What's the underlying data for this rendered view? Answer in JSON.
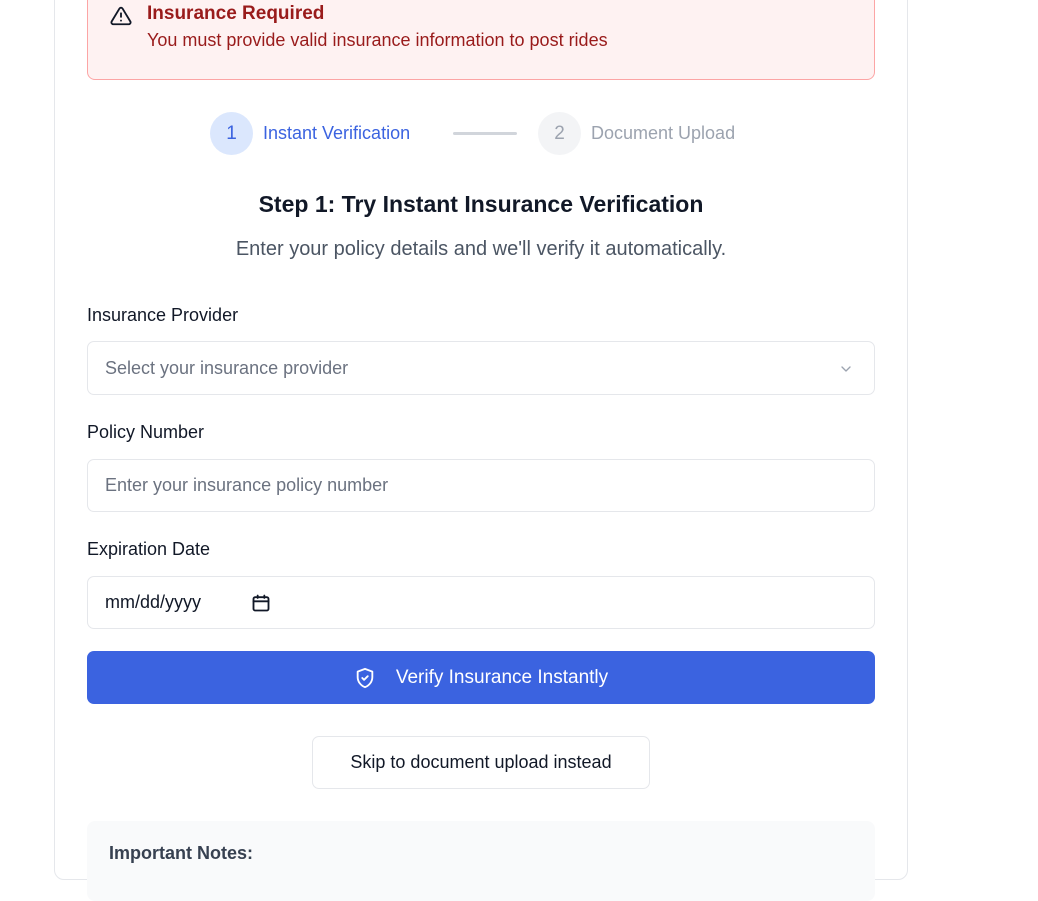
{
  "alert": {
    "title": "Insurance Required",
    "message": "You must provide valid insurance information to post rides",
    "icon": "warning-triangle-icon",
    "color": "#991b1b"
  },
  "steps": [
    {
      "number": "1",
      "label": "Instant Verification",
      "state": "active"
    },
    {
      "number": "2",
      "label": "Document Upload",
      "state": "inactive"
    }
  ],
  "heading": "Step 1: Try Instant Insurance Verification",
  "subheading": "Enter your policy details and we'll verify it automatically.",
  "form": {
    "provider": {
      "label": "Insurance Provider",
      "placeholder": "Select your insurance provider"
    },
    "policy": {
      "label": "Policy Number",
      "placeholder": "Enter your insurance policy number"
    },
    "expiration": {
      "label": "Expiration Date",
      "placeholder": "mm/dd/yyyy"
    }
  },
  "verify_button": {
    "label": "Verify Insurance Instantly",
    "icon": "shield-check-icon"
  },
  "skip_button": {
    "label": "Skip to document upload instead"
  },
  "notes": {
    "title": "Important Notes:"
  },
  "colors": {
    "accent": "#3b63e0",
    "alert_bg": "#fef2f2"
  }
}
